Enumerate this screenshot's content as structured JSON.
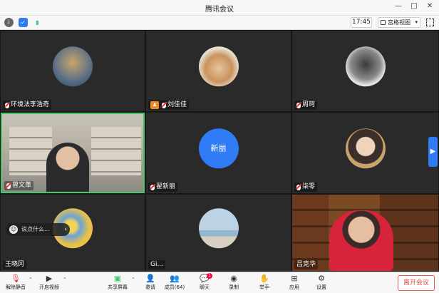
{
  "app_title": "腾讯会议",
  "toolbar": {
    "info_icon": "info-icon",
    "shield_icon": "shield-icon",
    "signal_icon": "signal-icon",
    "time": "17:45",
    "view_label": "宫格视图"
  },
  "participants": [
    {
      "name": "环境法李浩奇",
      "avatar": "photo-avatar",
      "muted": true
    },
    {
      "name": "刘佳佳",
      "avatar": "cat-avatar",
      "muted": true,
      "host": true
    },
    {
      "name": "周珂",
      "avatar": "photo-avatar",
      "muted": true
    },
    {
      "name": "曾文革",
      "avatar": "video",
      "muted": true,
      "active_speaker": true
    },
    {
      "name": "翟新丽",
      "avatar": "text-avatar",
      "avatar_text": "新丽",
      "muted": true
    },
    {
      "name": "柒零",
      "avatar": "photo-avatar",
      "muted": true
    },
    {
      "name": "王晓冈",
      "avatar": "flower-avatar",
      "muted": false
    },
    {
      "name": "Gi...",
      "avatar": "landscape-avatar",
      "muted": false
    },
    {
      "name": "吕克华",
      "avatar": "video",
      "muted": false
    }
  ],
  "chat": {
    "placeholder": "说点什么..."
  },
  "bottom_bar": {
    "unmute": "解除静音",
    "start_video": "开启视频",
    "share_screen": "共享屏幕",
    "invite": "邀请",
    "members": "成员(64)",
    "chat": "聊天",
    "chat_badge": "1",
    "record": "录制",
    "raise_hand": "举手",
    "apps": "应用",
    "settings": "设置",
    "leave": "离开会议"
  },
  "colors": {
    "active_border": "#3ec96a",
    "accent_blue": "#2f7cf6",
    "leave_red": "#e0473b",
    "host_orange": "#f08a24"
  }
}
